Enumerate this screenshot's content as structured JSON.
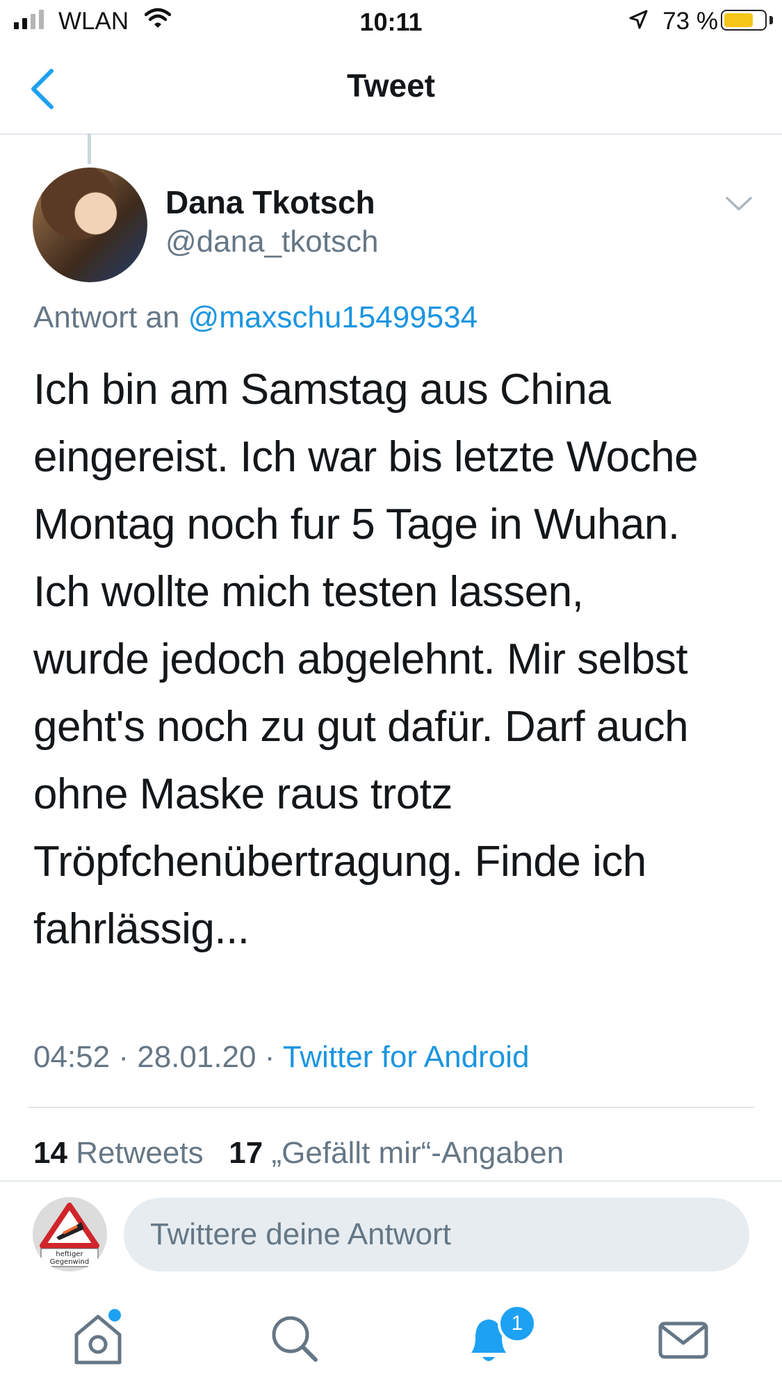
{
  "status_bar": {
    "carrier": "WLAN",
    "time": "10:11",
    "battery": "73 %",
    "battery_level": 0.73
  },
  "nav": {
    "title": "Tweet"
  },
  "tweet": {
    "display_name": "Dana Tkotsch",
    "handle": "@dana_tkotsch",
    "reply_prefix": "Antwort an ",
    "reply_to": "@maxschu15499534",
    "text_lines": [
      "Ich bin am Samstag aus China",
      "eingereist. Ich war bis letzte Woche",
      "Montag noch fur 5 Tage in Wuhan.",
      "Ich wollte mich testen lassen,",
      "wurde jedoch abgelehnt. Mir selbst",
      "geht's noch zu gut dafür. Darf auch",
      "ohne Maske raus trotz",
      "Tröpfchenübertragung. Finde ich",
      "fahrlässig..."
    ],
    "time": "04:52",
    "date": "28.01.20",
    "source": "Twitter for Android",
    "retweet_count": "14",
    "retweet_label": "Retweets",
    "like_count": "17",
    "like_label": "„Gefällt mir“-Angaben"
  },
  "composer": {
    "placeholder": "Twittere deine Antwort",
    "avatar_sign_text": "heftiger Gegenwind"
  },
  "tab_bar": {
    "notification_badge": "1",
    "accent_color": "#1da1f2"
  },
  "icons": [
    "signal-icon",
    "wifi-icon",
    "location-arrow-icon",
    "battery-icon",
    "back-chevron-icon",
    "chevron-down-icon",
    "home-icon",
    "search-icon",
    "bell-icon",
    "mail-icon"
  ]
}
